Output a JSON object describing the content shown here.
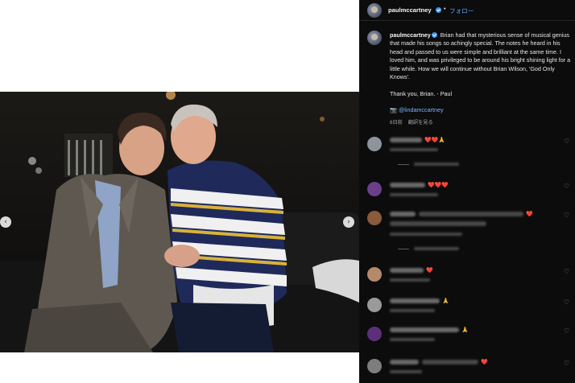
{
  "post": {
    "username": "paulmccartney",
    "follow_label": "フォロー",
    "separator": "•",
    "caption_user": "paulmccartney",
    "caption_text": "Brian had that mysterious sense of musical genius that made his songs so achingly special. The notes he heard in his head and passed to us were simple and brilliant at the same time. I loved him, and was privileged to be around his bright shining light for a little while. How we will continue without Brian Wilson, 'God Only Knows'.",
    "signoff": "Thank you, Brian. - Paul",
    "tag_icon": "📷",
    "tagged": "@lindamccartney",
    "time_ago": "6日前",
    "see_translation": "翻訳を見る"
  },
  "media": {
    "prev_icon": "‹",
    "next_icon": "›"
  },
  "comments": [
    {
      "avatar_color": "#8e949c",
      "name_width": 40,
      "text_width": 0,
      "icons": "❤️❤️🙏",
      "meta_width": 60,
      "reply": true
    },
    {
      "avatar_color": "#6a3f8a",
      "name_width": 44,
      "text_width": 0,
      "icons": "❤️❤️❤️",
      "meta_width": 60,
      "reply": false
    },
    {
      "avatar_color": "#8a5a3a",
      "name_width": 32,
      "text_width": 130,
      "icons": "❤️",
      "meta_width": 90,
      "reply": true,
      "two_lines": true
    },
    {
      "avatar_color": "#b58a6a",
      "name_width": 42,
      "text_width": 0,
      "icons": "❤️",
      "meta_width": 50,
      "reply": false
    },
    {
      "avatar_color": "#9a9a9a",
      "name_width": 62,
      "text_width": 0,
      "icons": "🙏",
      "meta_width": 56,
      "reply": false
    },
    {
      "avatar_color": "#5c2f7a",
      "name_width": 86,
      "text_width": 0,
      "icons": "🙏",
      "meta_width": 56,
      "reply": false
    },
    {
      "avatar_color": "#7d7d7d",
      "name_width": 36,
      "text_width": 70,
      "icons": "❤️",
      "meta_width": 40,
      "reply": false
    }
  ]
}
